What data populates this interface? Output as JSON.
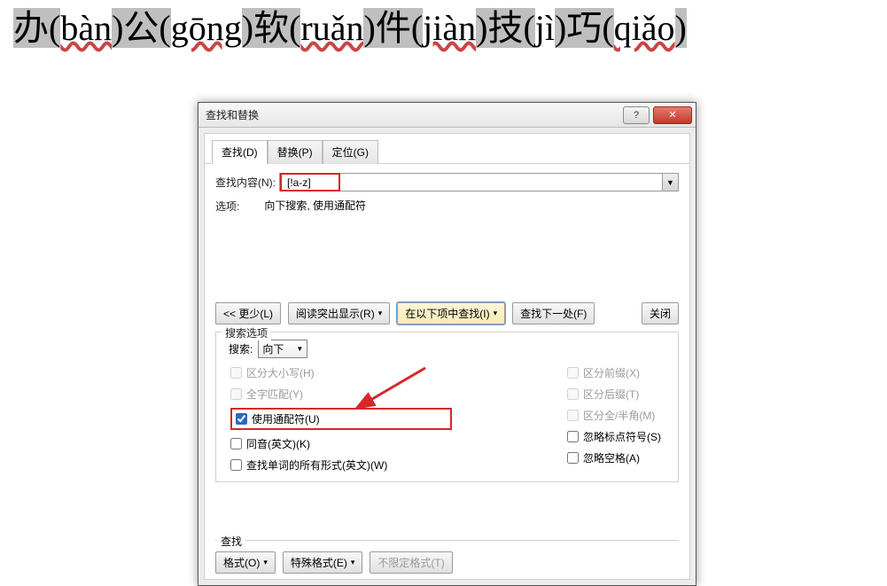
{
  "document": {
    "segments": [
      {
        "char": "办",
        "pinyin": "bàn"
      },
      {
        "char": "公",
        "pinyin": "gōng"
      },
      {
        "char": "软",
        "pinyin": "ruǎn"
      },
      {
        "char": "件",
        "pinyin": "jiàn"
      },
      {
        "char": "技",
        "pinyin": "jì"
      },
      {
        "char": "巧",
        "pinyin": "qiǎo"
      }
    ]
  },
  "dialog": {
    "title": "查找和替换",
    "tabs": {
      "find": "查找(D)",
      "replace": "替换(P)",
      "goto": "定位(G)"
    },
    "find_label": "查找内容(N):",
    "find_value": "[!a-z]",
    "options_label": "选项:",
    "options_value": "向下搜索, 使用通配符",
    "buttons": {
      "less": "<< 更少(L)",
      "reading_highlight": "阅读突出显示(R)",
      "find_in": "在以下项中查找(I)",
      "find_next": "查找下一处(F)",
      "close": "关闭"
    },
    "search_options_legend": "搜索选项",
    "search_dir_label": "搜索:",
    "search_dir_value": "向下",
    "checks": {
      "match_case": "区分大小写(H)",
      "whole_word": "全字匹配(Y)",
      "use_wildcards": "使用通配符(U)",
      "sounds_like": "同音(英文)(K)",
      "all_word_forms": "查找单词的所有形式(英文)(W)",
      "match_prefix": "区分前缀(X)",
      "match_suffix": "区分后缀(T)",
      "full_half": "区分全/半角(M)",
      "ignore_punct": "忽略标点符号(S)",
      "ignore_space": "忽略空格(A)"
    },
    "find_section_legend": "查找",
    "bottom_buttons": {
      "format": "格式(O)",
      "special": "特殊格式(E)",
      "no_format": "不限定格式(T)"
    }
  }
}
